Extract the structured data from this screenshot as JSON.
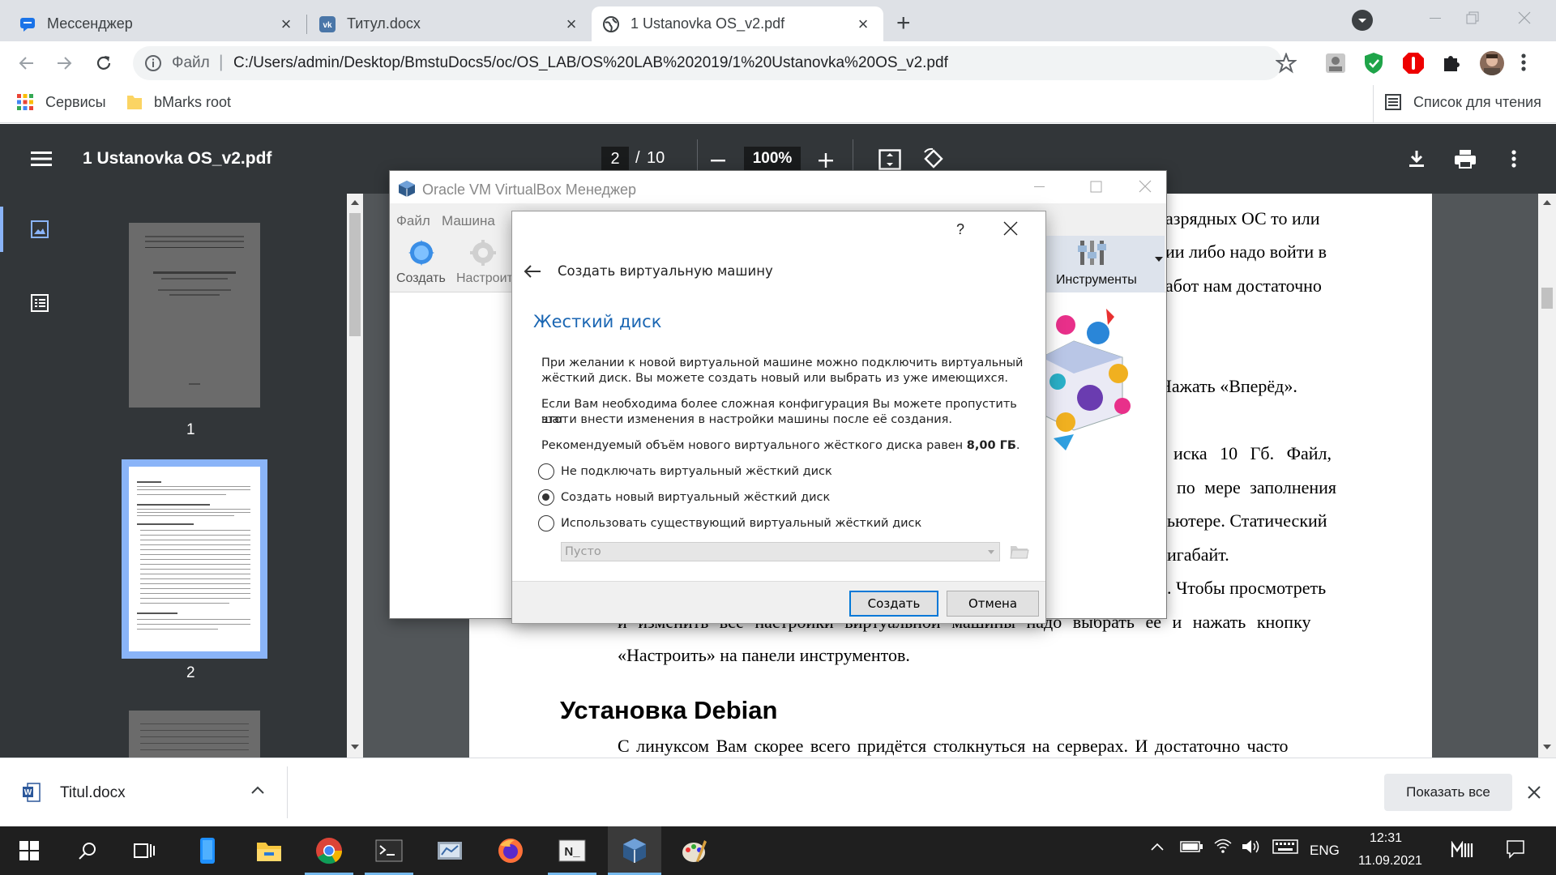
{
  "browser": {
    "tabs": [
      {
        "label": "Мессенджер",
        "icon": "messenger-icon",
        "active": false
      },
      {
        "label": "Титул.docx",
        "icon": "vk-icon",
        "active": false
      },
      {
        "label": "1 Ustanovka OS_v2.pdf",
        "icon": "globe-icon",
        "active": true
      }
    ],
    "new_tab": "+",
    "address_scheme": "Файл",
    "address_sep": "|",
    "url": "C:/Users/admin/Desktop/BmstuDocs5/oc/OS_LAB/OS%20LAB%202019/1%20Ustanovka%20OS_v2.pdf",
    "bookmarks": [
      {
        "label": "Сервисы",
        "icon": "apps-grid-icon"
      },
      {
        "label": "bMarks root",
        "icon": "folder-icon"
      }
    ],
    "reading_list": "Список для чтения"
  },
  "pdf": {
    "filename": "1 Ustanovka OS_v2.pdf",
    "page_current": "2",
    "page_sep": "/",
    "page_total": "10",
    "zoom": "100%",
    "thumbnails": [
      {
        "label": "1",
        "selected": false
      },
      {
        "label": "2",
        "selected": true
      }
    ],
    "lines": [
      "азрядных ОС то или",
      "ии либо надо войти в",
      "абот нам достаточно",
      "Нажать «Вперёд».",
      "иска 10 Гб. Файл,",
      "по мере заполнения",
      "ьютере. Статический",
      "игабайт.",
      ". Чтобы просмотреть",
      "и изменить все настройки виртуальной машины надо выбрать её и нажать кнопку",
      "«Настроить» на панели инструментов."
    ],
    "heading": "Установка Debian",
    "last_line": "С линуксом Вам скорее всего придётся столкнуться на серверах. И достаточно часто"
  },
  "vbox": {
    "title": "Oracle VM VirtualBox Менеджер",
    "menu": [
      "Файл",
      "Машина"
    ],
    "tools": [
      {
        "label": "Создать",
        "icon": "new-vm-icon"
      },
      {
        "label": "Настроить",
        "icon": "settings-gear-icon"
      }
    ],
    "tools_right": "Инструменты"
  },
  "dialog": {
    "help": "?",
    "back_title": "Создать виртуальную машину",
    "heading": "Жесткий диск",
    "para1_l1": "При желании к новой виртуальной машине можно подключить виртуальный",
    "para1_l2": "жёсткий диск. Вы можете создать новый или выбрать из уже имеющихся.",
    "para2_l1": "Если Вам необходима более сложная конфигурация Вы можете пропустить этот",
    "para2_l2": "шаг и внести изменения в настройки машины после её создания.",
    "recommend": "Рекомендуемый объём нового виртуального жёсткого диска равен",
    "recommend_value": "8,00 ГБ",
    "recommend_end": ".",
    "options": [
      {
        "label": "Не подключать виртуальный жёсткий диск",
        "selected": false
      },
      {
        "label": "Создать новый виртуальный жёсткий диск",
        "selected": true
      },
      {
        "label": "Использовать существующий виртуальный жёсткий диск",
        "selected": false
      }
    ],
    "combo_value": "Пусто",
    "create_button": "Создать",
    "cancel_button": "Отмена"
  },
  "downloads": {
    "file": "Titul.docx",
    "show_all": "Показать все"
  },
  "taskbar": {
    "lang": "ENG",
    "time": "12:31",
    "date": "11.09.2021"
  },
  "colors": {
    "chrome_tabstrip": "#dee1e6",
    "pdf_toolbar": "#323639",
    "pdf_background": "#525659",
    "thumb_selected": "#8ab4f8",
    "dialog_heading": "#1a66b3",
    "taskbar": "#1f1f1f"
  }
}
